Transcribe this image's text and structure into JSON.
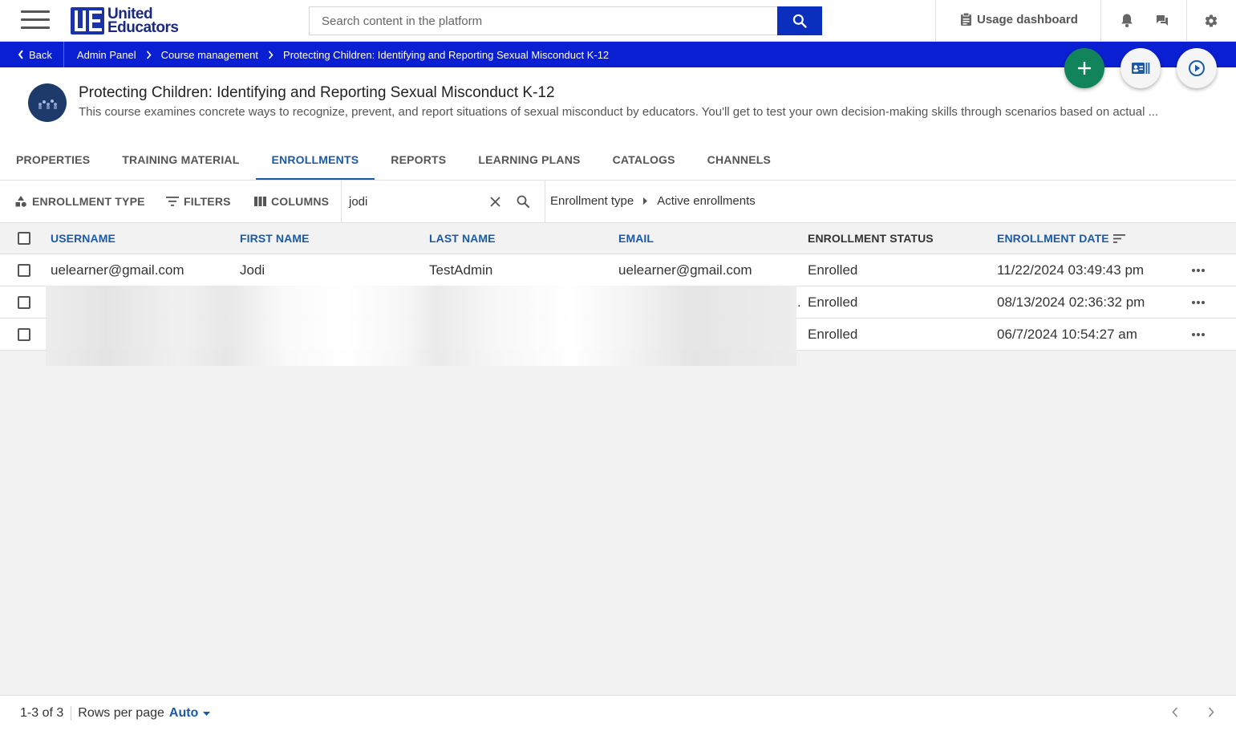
{
  "header": {
    "logo_line1": "United",
    "logo_line2": "Educators",
    "search_placeholder": "Search content in the platform",
    "usage_dashboard": "Usage dashboard"
  },
  "breadcrumb": {
    "back": "Back",
    "items": [
      "Admin Panel",
      "Course management",
      "Protecting Children: Identifying and Reporting Sexual Misconduct K-12"
    ]
  },
  "course": {
    "title": "Protecting Children: Identifying and Reporting Sexual Misconduct K-12",
    "description": "This course examines concrete ways to recognize, prevent, and report situations of sexual misconduct by educators. You'll get to test your own decision-making skills through scenarios based on actual ..."
  },
  "tabs": [
    "PROPERTIES",
    "TRAINING MATERIAL",
    "ENROLLMENTS",
    "REPORTS",
    "LEARNING PLANS",
    "CATALOGS",
    "CHANNELS"
  ],
  "active_tab": "ENROLLMENTS",
  "toolbar": {
    "enrollment_type": "ENROLLMENT TYPE",
    "filters": "FILTERS",
    "columns": "COLUMNS",
    "search_value": "jodi",
    "crumb_1": "Enrollment type",
    "crumb_2": "Active enrollments"
  },
  "table": {
    "columns": [
      "USERNAME",
      "FIRST NAME",
      "LAST NAME",
      "EMAIL",
      "ENROLLMENT STATUS",
      "ENROLLMENT DATE"
    ],
    "rows": [
      {
        "username": "uelearner@gmail.com",
        "first_name": "Jodi",
        "last_name": "TestAdmin",
        "email": "uelearner@gmail.com",
        "status": "Enrolled",
        "date": "11/22/2024 03:49:43 pm"
      },
      {
        "username": "",
        "first_name": "",
        "last_name": "",
        "email": ".",
        "status": "Enrolled",
        "date": "08/13/2024 02:36:32 pm"
      },
      {
        "username": "",
        "first_name": "",
        "last_name": "",
        "email": "",
        "status": "Enrolled",
        "date": "06/7/2024 10:54:27 am"
      }
    ]
  },
  "footer": {
    "count": "1-3 of 3",
    "rows_per_page_label": "Rows per page",
    "rows_per_page_value": "Auto"
  },
  "colors": {
    "brand_blue": "#0a1fd1",
    "search_button": "#0a2fbf",
    "link_blue": "#1a5aa6",
    "fab_green": "#11845b"
  }
}
